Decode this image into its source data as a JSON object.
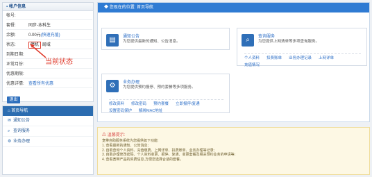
{
  "account": {
    "title": "帐户信息",
    "rows": [
      {
        "label": "帐号:",
        "value": ""
      },
      {
        "label": "套餐:",
        "value": "同步-本科生"
      },
      {
        "label": "余额:",
        "value": "0.00元",
        "link": "(快速充值)"
      },
      {
        "label": "状态:",
        "value": "停机",
        "extra": "局域"
      },
      {
        "label": "到期日期:",
        "value": ""
      },
      {
        "label": "正常月份:",
        "value": ""
      },
      {
        "label": "优惠期限:",
        "value": ""
      },
      {
        "label": "优惠详情:",
        "link": "查看所有优惠"
      }
    ],
    "logout": "退出"
  },
  "annotation": "当前状态",
  "nav": {
    "header": "首页导航",
    "items": [
      {
        "label": "通知公告",
        "icon": "envelope-icon"
      },
      {
        "label": "查询服务",
        "icon": "search-icon"
      },
      {
        "label": "业务办理",
        "icon": "gear-icon"
      }
    ]
  },
  "main": {
    "breadcrumb": "您现在的位置: 首页导航",
    "cards": {
      "notice": {
        "title": "通知公告",
        "desc": "为您提供最新的通知、公告消息。",
        "links": []
      },
      "query": {
        "title": "查询服务",
        "desc": "为您提供上网清单等多项查询服务。",
        "links": [
          "个人资料",
          "扣费账单",
          "业务办理记录",
          "上网详单",
          "充值情况"
        ]
      },
      "business": {
        "title": "业务办理",
        "desc": "为您提供预约报停、预约套餐等多项服务。",
        "links": [
          "修改资料",
          "修改密码",
          "预约套餐",
          "立即报停/复通",
          "设置密码保护",
          "解绑MAC地址"
        ]
      }
    }
  },
  "tips": {
    "title": "温馨提示:",
    "lines": [
      "宽带自助服务系统为您提供如下功能:",
      "1. 查看最新的通知、公告消息;",
      "2. 自助查询个人资料、充值缴费、上网详单、扣费账单、业务办理等记录;",
      "3. 自助办理修改密码、个人资料变更、报停、复通、变更套餐及相关预约业务的申请等;",
      "4. 查看宽带产品的资费信息,方便您选择合适的套餐。"
    ]
  }
}
